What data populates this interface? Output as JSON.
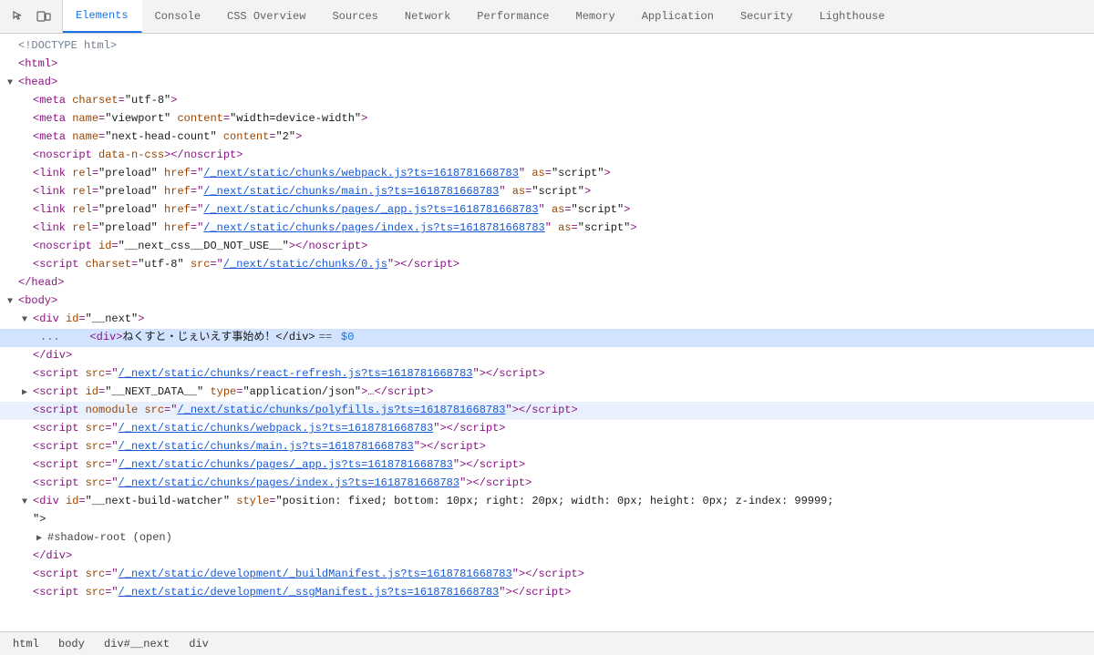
{
  "tabs": [
    {
      "id": "elements",
      "label": "Elements",
      "active": true
    },
    {
      "id": "console",
      "label": "Console",
      "active": false
    },
    {
      "id": "css-overview",
      "label": "CSS Overview",
      "active": false
    },
    {
      "id": "sources",
      "label": "Sources",
      "active": false
    },
    {
      "id": "network",
      "label": "Network",
      "active": false
    },
    {
      "id": "performance",
      "label": "Performance",
      "active": false
    },
    {
      "id": "memory",
      "label": "Memory",
      "active": false
    },
    {
      "id": "application",
      "label": "Application",
      "active": false
    },
    {
      "id": "security",
      "label": "Security",
      "active": false
    },
    {
      "id": "lighthouse",
      "label": "Lighthouse",
      "active": false
    }
  ],
  "breadcrumbs": [
    {
      "label": "html"
    },
    {
      "label": "body"
    },
    {
      "label": "div#__next"
    },
    {
      "label": "div"
    }
  ],
  "lines": [
    {
      "indent": 0,
      "content": "doctype",
      "type": "doctype"
    },
    {
      "indent": 0,
      "content": "html_open",
      "type": "html_open"
    },
    {
      "indent": 0,
      "content": "head_open",
      "type": "head_open",
      "triangle": "open"
    },
    {
      "indent": 1,
      "content": "meta_charset",
      "type": "meta_charset"
    },
    {
      "indent": 1,
      "content": "meta_viewport",
      "type": "meta_viewport"
    },
    {
      "indent": 1,
      "content": "meta_head_count",
      "type": "meta_head_count"
    },
    {
      "indent": 1,
      "content": "noscript_css",
      "type": "noscript_css"
    },
    {
      "indent": 1,
      "content": "link_webpack",
      "type": "link_preload_webpack"
    },
    {
      "indent": 1,
      "content": "link_main",
      "type": "link_preload_main"
    },
    {
      "indent": 1,
      "content": "link_pages_app",
      "type": "link_preload_pages_app"
    },
    {
      "indent": 1,
      "content": "link_pages_index",
      "type": "link_preload_pages_index"
    },
    {
      "indent": 1,
      "content": "noscript_css2",
      "type": "noscript_css2"
    },
    {
      "indent": 1,
      "content": "script_0_js",
      "type": "script_0_js"
    },
    {
      "indent": 0,
      "content": "head_close",
      "type": "head_close"
    },
    {
      "indent": 0,
      "content": "body_open",
      "type": "body_open",
      "triangle": "open"
    },
    {
      "indent": 1,
      "content": "div_next_open",
      "type": "div_next_open",
      "triangle": "open"
    },
    {
      "indent": 2,
      "content": "div_japanese",
      "type": "div_japanese",
      "selected": true
    },
    {
      "indent": 1,
      "content": "div_close",
      "type": "div_close"
    },
    {
      "indent": 1,
      "content": "script_react_refresh",
      "type": "script_react_refresh"
    },
    {
      "indent": 1,
      "content": "script_next_data",
      "type": "script_next_data",
      "triangle": "closed"
    },
    {
      "indent": 1,
      "content": "script_polyfills",
      "type": "script_polyfills",
      "highlighted": true
    },
    {
      "indent": 1,
      "content": "script_webpack",
      "type": "script_webpack"
    },
    {
      "indent": 1,
      "content": "script_main",
      "type": "script_main"
    },
    {
      "indent": 1,
      "content": "script_pages_app",
      "type": "script_pages_app"
    },
    {
      "indent": 1,
      "content": "script_pages_index",
      "type": "script_pages_index"
    },
    {
      "indent": 1,
      "content": "div_build_watcher_open",
      "type": "div_build_watcher_open",
      "triangle": "open"
    },
    {
      "indent": 1,
      "content": "div_build_watcher_cont",
      "type": "div_build_watcher_cont"
    },
    {
      "indent": 2,
      "content": "shadow_root",
      "type": "shadow_root",
      "triangle": "closed"
    },
    {
      "indent": 1,
      "content": "div_build_watcher_close",
      "type": "div_build_watcher_close"
    },
    {
      "indent": 1,
      "content": "script_build_manifest",
      "type": "script_build_manifest"
    },
    {
      "indent": 1,
      "content": "script_css_manifest",
      "type": "script_css_manifest"
    }
  ]
}
